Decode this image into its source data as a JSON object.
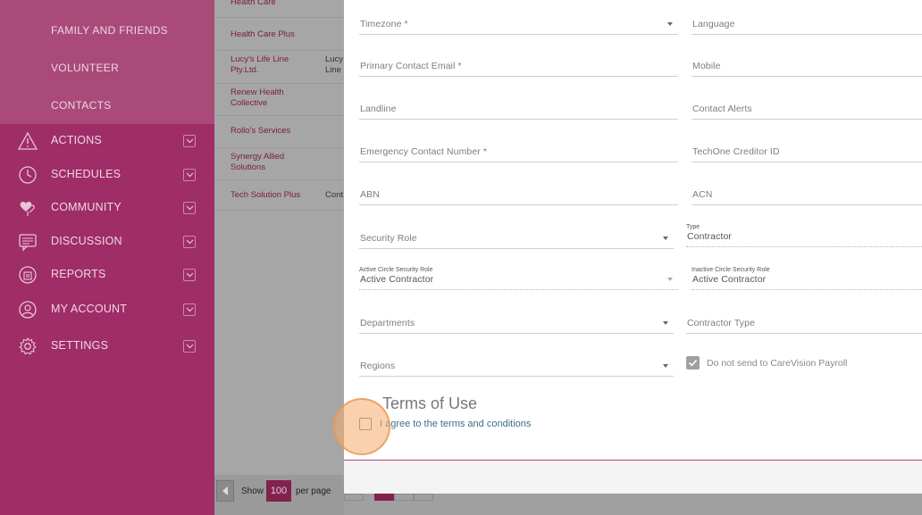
{
  "sidebar": {
    "sub_items": [
      "FAMILY AND FRIENDS",
      "VOLUNTEER",
      "CONTACTS"
    ],
    "nav": [
      {
        "label": "ACTIONS",
        "icon": "warning-icon"
      },
      {
        "label": "SCHEDULES",
        "icon": "clock-icon"
      },
      {
        "label": "COMMUNITY",
        "icon": "hearts-icon"
      },
      {
        "label": "DISCUSSION",
        "icon": "chat-icon"
      },
      {
        "label": "REPORTS",
        "icon": "reports-icon"
      },
      {
        "label": "MY ACCOUNT",
        "icon": "user-icon"
      },
      {
        "label": "SETTINGS",
        "icon": "gear-icon"
      }
    ]
  },
  "background_list": {
    "rows": [
      {
        "name": "Health Care",
        "extra": ""
      },
      {
        "name": "Health Care Plus",
        "extra": ""
      },
      {
        "name": "Lucy's Life Line Pty.Ltd.",
        "extra": "Lucy Line"
      },
      {
        "name": "Renew Health Collective",
        "extra": ""
      },
      {
        "name": "Rollo's Services",
        "extra": ""
      },
      {
        "name": "Synergy Allied Solutions",
        "extra": ""
      },
      {
        "name": "Tech Solution Plus",
        "extra": "Cont"
      }
    ],
    "pager": {
      "show": "Show",
      "per_page_value": "100",
      "per_page": "per page"
    }
  },
  "form": {
    "timezone": "Timezone *",
    "language": "Language",
    "primary_email": "Primary Contact Email *",
    "mobile": "Mobile",
    "landline": "Landline",
    "contact_alerts": "Contact Alerts",
    "emergency": "Emergency Contact Number *",
    "techone": "TechOne Creditor ID",
    "abn": "ABN",
    "acn": "ACN",
    "security_role": "Security Role",
    "type_label": "Type",
    "type_value": "Contractor",
    "active_role_label": "Active Circle Security Role",
    "active_role_value": "Active Contractor",
    "inactive_role_label": "Inactive Circle Security Role",
    "inactive_role_value": "Active Contractor",
    "departments": "Departments",
    "contractor_type": "Contractor Type",
    "regions": "Regions",
    "do_not_send": "Do not send to CareVision Payroll",
    "terms_title": "Terms of Use",
    "terms_agree": "I agree to the terms and conditions"
  },
  "colors": {
    "sidebar": "#9f2d67",
    "accent": "#80234f",
    "link": "#3a6f8e",
    "highlight": "#f4ac6e"
  }
}
